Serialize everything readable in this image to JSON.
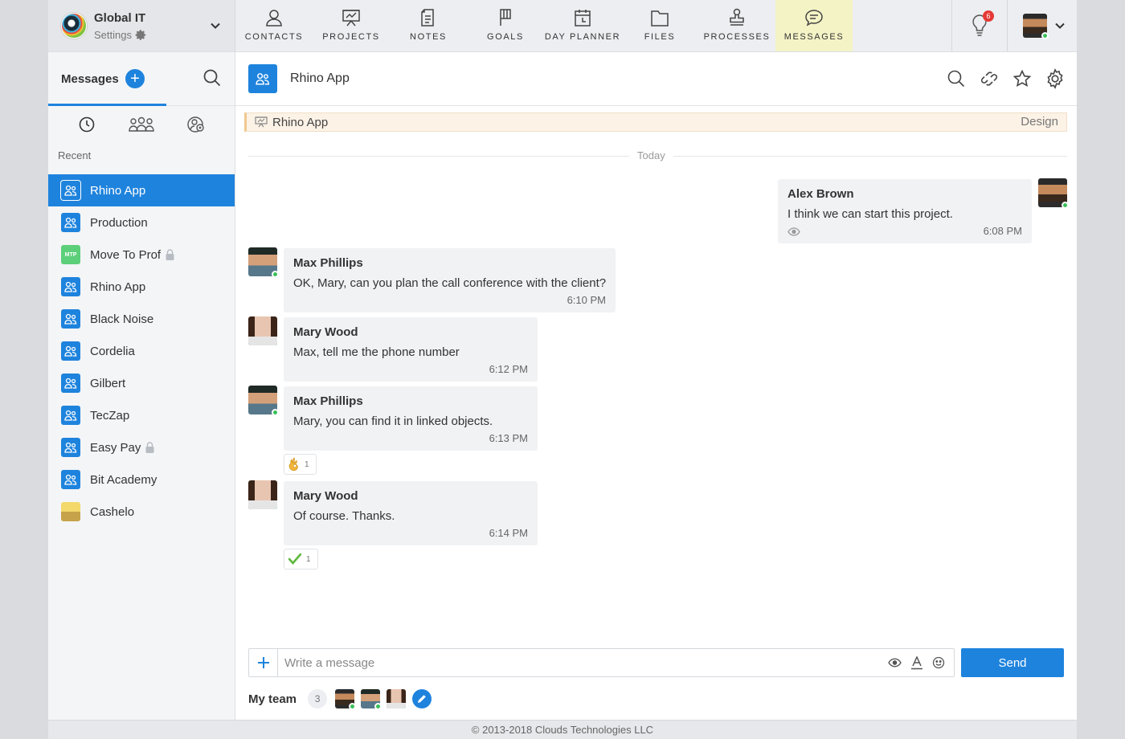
{
  "org": {
    "name": "Global IT",
    "settings_label": "Settings"
  },
  "nav": [
    {
      "label": "CONTACTS",
      "icon": "contacts-icon"
    },
    {
      "label": "PROJECTS",
      "icon": "projects-icon"
    },
    {
      "label": "NOTES",
      "icon": "notes-icon"
    },
    {
      "label": "GOALS",
      "icon": "goals-icon"
    },
    {
      "label": "DAY PLANNER",
      "icon": "day-planner-icon"
    },
    {
      "label": "FILES",
      "icon": "files-icon"
    },
    {
      "label": "PROCESSES",
      "icon": "processes-icon"
    },
    {
      "label": "MESSAGES",
      "icon": "messages-icon",
      "active": true
    }
  ],
  "notifications": {
    "count": "6"
  },
  "sidebar": {
    "title": "Messages",
    "add_label": "+",
    "recent_label": "Recent",
    "chats": [
      {
        "name": "Rhino App",
        "icon": "group-icon",
        "active": true
      },
      {
        "name": "Production",
        "icon": "group-icon"
      },
      {
        "name": "Move To Prof",
        "icon": "mtp-logo",
        "icon_text": "MTP",
        "locked": true
      },
      {
        "name": "Rhino App",
        "icon": "group-icon"
      },
      {
        "name": "Black Noise",
        "icon": "group-icon"
      },
      {
        "name": "Cordelia",
        "icon": "group-icon"
      },
      {
        "name": "Gilbert",
        "icon": "group-icon"
      },
      {
        "name": "TecZap",
        "icon": "group-icon"
      },
      {
        "name": "Easy Pay",
        "icon": "group-icon",
        "locked": true
      },
      {
        "name": "Bit Academy",
        "icon": "group-icon"
      },
      {
        "name": "Cashelo",
        "icon": "cashelo-logo"
      }
    ]
  },
  "channel": {
    "title": "Rhino App",
    "linked_object": {
      "name": "Rhino App",
      "tag": "Design"
    },
    "day_label": "Today"
  },
  "messages": [
    {
      "author": "Alex Brown",
      "text": "I think we can start this project.",
      "time": "6:08 PM",
      "own": true
    },
    {
      "author": "Max Phillips",
      "text": "OK, Mary, can you plan the call conference with the client?",
      "time": "6:10 PM"
    },
    {
      "author": "Mary Wood",
      "text": "Max, tell me the phone number",
      "time": "6:12 PM"
    },
    {
      "author": "Max Phillips",
      "text": "Mary, you can find it in linked objects.",
      "time": "6:13 PM",
      "reaction": {
        "emoji": "ok-hand-emoji",
        "count": "1"
      }
    },
    {
      "author": "Mary Wood",
      "text": "Of course. Thanks.",
      "time": "6:14 PM",
      "reaction": {
        "emoji": "check-mark-emoji",
        "count": "1"
      }
    }
  ],
  "composer": {
    "placeholder": "Write a message",
    "send_label": "Send"
  },
  "team": {
    "label": "My team",
    "count": "3"
  },
  "footer": {
    "text": "© 2013-2018 Clouds Technologies LLC"
  },
  "colors": {
    "accent": "#1e83dd",
    "active_nav": "#f4f3c6",
    "badge": "#e53935",
    "online": "#3bbf5a"
  }
}
